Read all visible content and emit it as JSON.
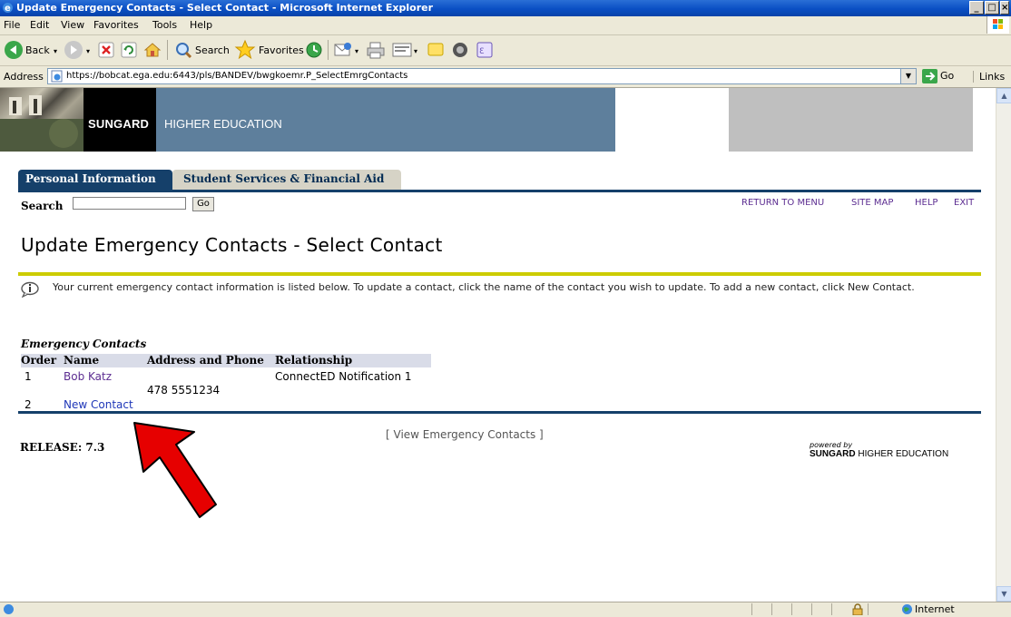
{
  "window": {
    "title": "Update Emergency Contacts - Select Contact - Microsoft Internet Explorer",
    "controls": [
      "_",
      "□",
      "×"
    ]
  },
  "menu": {
    "items": [
      "File",
      "Edit",
      "View",
      "Favorites",
      "Tools",
      "Help"
    ]
  },
  "toolbar": {
    "back": "Back",
    "search": "Search",
    "favorites": "Favorites"
  },
  "address": {
    "label": "Address",
    "url": "https://bobcat.ega.edu:6443/pls/BANDEV/bwgkoemr.P_SelectEmrgContacts",
    "go": "Go",
    "links": "Links"
  },
  "banner": {
    "brand_bold": "SUNGARD",
    "brand_rest": "HIGHER EDUCATION"
  },
  "tabs": [
    {
      "label": "Personal Information",
      "active": true
    },
    {
      "label": "Student Services & Financial Aid",
      "active": false
    }
  ],
  "search": {
    "label": "Search",
    "value": "",
    "go": "Go"
  },
  "top_links": [
    "RETURN TO MENU",
    "SITE MAP",
    "HELP",
    "EXIT"
  ],
  "page": {
    "title": "Update Emergency Contacts - Select Contact",
    "info": "Your current emergency contact information is listed below. To update a contact, click the name of the contact you wish to update. To add a new contact, click New Contact."
  },
  "contacts": {
    "caption": "Emergency Contacts",
    "headers": [
      "Order",
      "Name",
      "Address and Phone",
      "Relationship"
    ],
    "rows": [
      {
        "order": "1",
        "name": "Bob Katz",
        "phone": "478 5551234",
        "relationship": "ConnectED Notification 1"
      },
      {
        "order": "2",
        "name": "New Contact",
        "phone": "",
        "relationship": ""
      }
    ]
  },
  "footer": {
    "view_link": "[ View Emergency Contacts ]",
    "release": "RELEASE: 7.3",
    "powered_by": "powered by",
    "brand_bold": "SUNGARD",
    "brand_rest": "HIGHER EDUCATION"
  },
  "status": {
    "zone": "Internet"
  },
  "colors": {
    "title_bar": "#0a4fc4",
    "tab_active": "#15406a",
    "banner_blue": "#5e7f9c",
    "link": "#5c2d91",
    "annotation_arrow": "#e60000"
  }
}
